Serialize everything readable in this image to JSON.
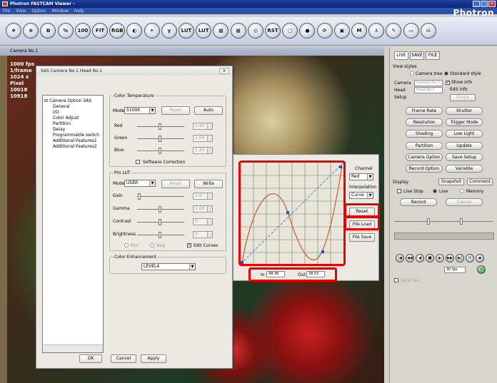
{
  "app": {
    "title": "Photron FASTCAM Viewer -",
    "brand": "Photron",
    "menu": [
      "File",
      "View",
      "Option",
      "Window",
      "Help"
    ]
  },
  "toolbar": {
    "icons": [
      {
        "name": "move-icon",
        "label": "✥"
      },
      {
        "name": "zoom-icon",
        "label": "⊕"
      },
      {
        "name": "crop-icon",
        "label": "⧉"
      },
      {
        "name": "percent-icon",
        "label": "%"
      },
      {
        "name": "zoom-100-icon",
        "label": "100"
      },
      {
        "name": "fit-icon",
        "label": "FIT"
      },
      {
        "name": "rgb-icon",
        "label": "RGB"
      },
      {
        "name": "contrast-icon",
        "label": "◐"
      },
      {
        "name": "brightness-icon",
        "label": "☀"
      },
      {
        "name": "gamma-icon",
        "label": "γ"
      },
      {
        "name": "lut-icon",
        "label": "LUT"
      },
      {
        "name": "lut-reset-icon",
        "label": "LUT"
      },
      {
        "name": "color-icon",
        "label": "▦"
      },
      {
        "name": "color-reset-icon",
        "label": "▦"
      },
      {
        "name": "rgb-circle-icon",
        "label": "◎"
      },
      {
        "name": "reset-icon",
        "label": "RST"
      },
      {
        "name": "window-icon",
        "label": "▢"
      },
      {
        "name": "record-icon",
        "label": "●"
      },
      {
        "name": "refresh-icon",
        "label": "⟳"
      },
      {
        "name": "multi-camera-icon",
        "label": "▣"
      },
      {
        "name": "multi-lock-icon",
        "label": "M"
      },
      {
        "name": "hook-icon",
        "label": "⚓"
      },
      {
        "name": "pen-icon",
        "label": "✎"
      },
      {
        "name": "screen-icon",
        "label": "▭"
      },
      {
        "name": "storage-icon",
        "label": "⛁"
      }
    ]
  },
  "camera": {
    "title": "Camera No.1",
    "overlay": [
      "1000 fps",
      "1/frame",
      "1024 x",
      "Pixel",
      "10018",
      "10918"
    ]
  },
  "dialog": {
    "title": "SAS Camera No.1 Head No.1",
    "tree": [
      "Camera Option SAS",
      "General",
      "I/O",
      "Color Adjust",
      "Partition",
      "Delay",
      "Programmable switch",
      "Additional Features1",
      "Additional Features2"
    ],
    "color_temp": {
      "group": "Color Temperature",
      "mode_label": "Mode",
      "mode": "5100K",
      "reset": "Reset",
      "auto": "Auto",
      "red": "Red",
      "green": "Green",
      "blue": "Blue",
      "red_val": "1.90",
      "green_val": "1.04",
      "blue_val": "1.25",
      "sw_correction": "Software Correction"
    },
    "pro_lut": {
      "group": "Pro LUT",
      "mode_label": "Mode",
      "mode": "USER",
      "reset": "Reset",
      "write": "Write",
      "gain": "Gain",
      "gamma": "Gamma",
      "contrast": "Contrast",
      "brightness": "Brightness",
      "gain_val": "1.0",
      "gamma_val": "1.00",
      "contrast_val": "0",
      "brightness_val": "0",
      "pos": "Pos",
      "neg": "Neg",
      "edit_curves": "Edit Curves"
    },
    "enhance": {
      "group": "Color Enhancement",
      "value": "LEVEL4"
    },
    "ok": "OK",
    "cancel": "Cancel",
    "apply": "Apply"
  },
  "curve": {
    "channel_label": "Channel",
    "channel": "Red",
    "interp_label": "Interpolation",
    "interp": "Curve",
    "reset": "Reset",
    "load": "File Load",
    "save": "File Save",
    "in_label": "In",
    "in_val": "48.36",
    "out_label": "Out",
    "out_val": "38.53",
    "colors": {
      "frame": "#e00000",
      "curve": "#cc6040",
      "diagonal": "#5a8ac8"
    }
  },
  "panel": {
    "tabs": [
      "LIVE",
      "SAVE",
      "FILE"
    ],
    "view_styles": "View styles",
    "camera_tree": "Camera tree",
    "standard_style": "Standard style",
    "camera_label": "Camera",
    "camera_val": "Camera No.1",
    "head_label": "Head",
    "head_val": "Head No.1",
    "setup": "Setup",
    "show_info": "Show info",
    "edit_info": "Edit info",
    "single": "Single",
    "buttons": [
      "Frame Rate",
      "Shutter",
      "Resolution",
      "Trigger Mode",
      "Shading",
      "Low Light",
      "Partition",
      "Update",
      "Camera Option",
      "Save Setup",
      "Record Option",
      "Variable"
    ],
    "display": "Display",
    "snapshot": "Snapshot",
    "comment": "Comment",
    "live_stop": "Live Stop",
    "live": "Live",
    "memory": "Memory",
    "record": "Record",
    "cancel": "Cancel",
    "fps": "30 fps",
    "sync": "Sync rec"
  }
}
